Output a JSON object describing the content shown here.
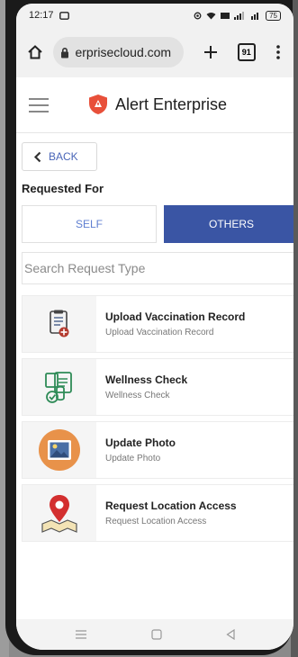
{
  "status_bar": {
    "time": "12:17",
    "battery": "75"
  },
  "browser": {
    "url": "erprisecloud.com",
    "tab_count": "91"
  },
  "app_header": {
    "brand_name": "Alert Enterprise"
  },
  "page": {
    "back_label": "BACK",
    "section_title": "Requested For",
    "segments": {
      "self_label": "SELF",
      "others_label": "OTHERS",
      "selected": "OTHERS"
    },
    "search_placeholder": "Search Request Type"
  },
  "request_types": [
    {
      "title": "Upload Vaccination Record",
      "subtitle": "Upload Vaccination Record",
      "icon": "vaccination-record-icon"
    },
    {
      "title": "Wellness Check",
      "subtitle": "Wellness Check",
      "icon": "wellness-check-icon"
    },
    {
      "title": "Update Photo",
      "subtitle": "Update Photo",
      "icon": "photo-icon"
    },
    {
      "title": "Request Location Access",
      "subtitle": "Request Location Access",
      "icon": "location-pin-icon"
    }
  ],
  "colors": {
    "accent": "#3a55a4",
    "link": "#4a66b8",
    "brand_shield": "#e8503a"
  }
}
